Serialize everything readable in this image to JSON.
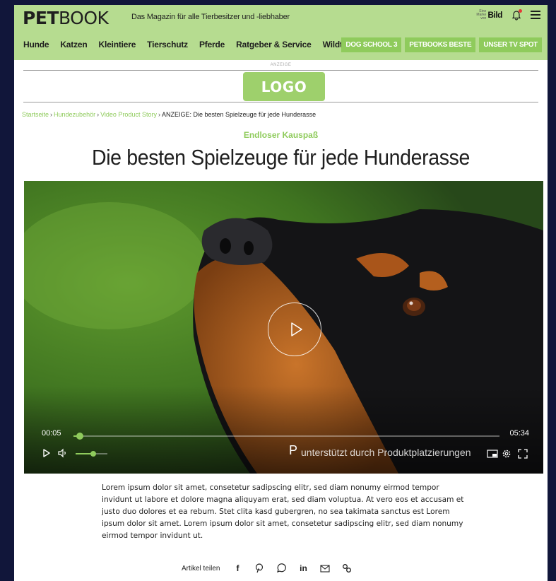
{
  "header": {
    "brand_bold": "PET",
    "brand_light": "BOOK",
    "tagline": "Das Magazin für alle Tierbesitzer und -liebhaber",
    "bild_small": "Eine Marke von",
    "bild_big": "Bild"
  },
  "nav": {
    "items": [
      "Hunde",
      "Katzen",
      "Kleintiere",
      "Tierschutz",
      "Pferde",
      "Ratgeber & Service",
      "Wildtiere"
    ],
    "buttons": [
      "DOG SCHOOL 3",
      "PETBOOKS BESTE",
      "UNSER TV SPOT"
    ]
  },
  "ad": {
    "label": "ANZEIGE",
    "logo": "LOGO"
  },
  "breadcrumb": {
    "links": [
      "Startseite",
      "Hundezubehör",
      "Video Product Story"
    ],
    "current": "ANZEIGE: Die besten Spielzeuge für jede Hunderasse"
  },
  "article": {
    "kicker": "Endloser Kauspaß",
    "title": "Die besten Spielzeuge für jede Hunderasse",
    "body": "Lorem ipsum dolor sit amet, consetetur sadipscing elitr, sed diam nonumy eirmod tempor invidunt ut labore et dolore magna aliquyam erat, sed diam voluptua. At vero eos et accusam et justo duo dolores et ea rebum. Stet clita kasd gubergren, no sea takimata sanctus est Lorem ipsum dolor sit amet. Lorem ipsum dolor sit amet, consetetur sadipscing elitr, sed diam nonumy eirmod tempor invidunt ut."
  },
  "video": {
    "current_time": "00:05",
    "total_time": "05:34",
    "progress_fraction": 0.015,
    "volume_fraction": 0.55,
    "placement_badge": "P",
    "placement_text": "unterstützt durch Produktplatzierungen"
  },
  "share": {
    "label": "Artikel teilen",
    "icons": [
      "facebook-icon",
      "pinterest-icon",
      "whatsapp-icon",
      "linkedin-icon",
      "mail-icon",
      "link-icon"
    ],
    "glyphs": {
      "facebook": "f",
      "linkedin": "in"
    }
  },
  "colors": {
    "header_bg": "#b6dc90",
    "accent": "#8fcb5c",
    "outer_bg": "#11163a"
  }
}
